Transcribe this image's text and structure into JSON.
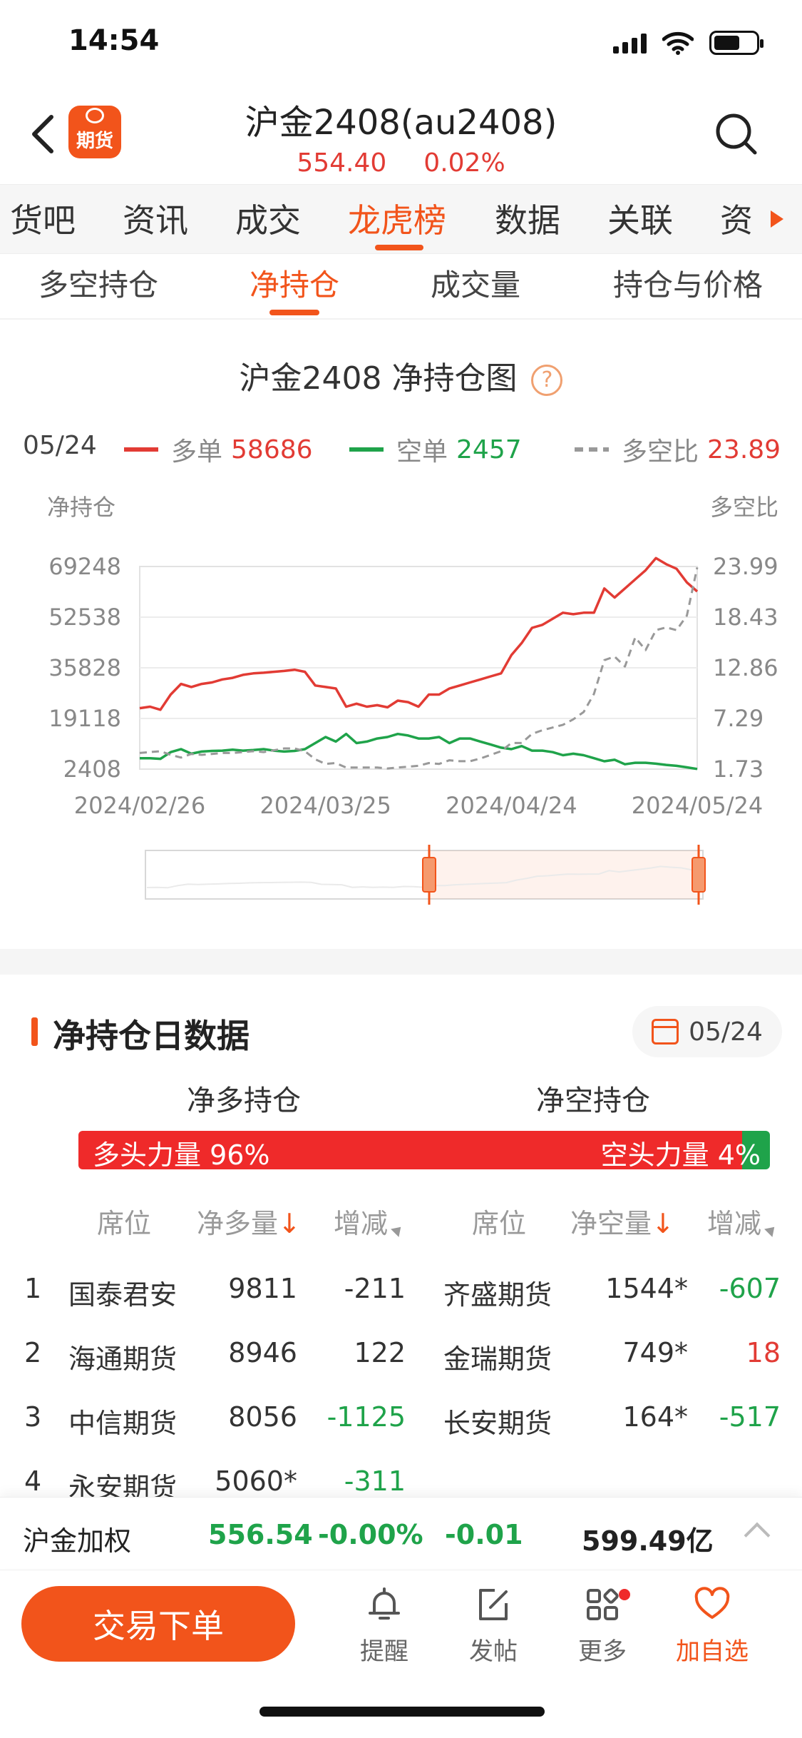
{
  "status_bar": {
    "time": "14:54"
  },
  "header": {
    "logo_text": "期货",
    "title": "沪金2408(au2408)",
    "price": "554.40",
    "change_pct": "0.02%"
  },
  "tabs": [
    {
      "label": "货吧"
    },
    {
      "label": "资讯"
    },
    {
      "label": "成交"
    },
    {
      "label": "龙虎榜"
    },
    {
      "label": "数据"
    },
    {
      "label": "关联"
    },
    {
      "label": "资"
    }
  ],
  "subtabs": [
    {
      "label": "多空持仓"
    },
    {
      "label": "净持仓"
    },
    {
      "label": "成交量"
    },
    {
      "label": "持仓与价格"
    }
  ],
  "chart_section": {
    "title": "沪金2408  净持仓图",
    "help": "?",
    "legend_date": "05/24",
    "legend": [
      {
        "name": "多单",
        "value": "58686",
        "color": "#e23b34"
      },
      {
        "name": "空单",
        "value": "2457",
        "color": "#1fa34a"
      },
      {
        "name": "多空比",
        "value": "23.89",
        "color": "#999999"
      }
    ]
  },
  "chart_data": {
    "type": "line",
    "ylabel_left": "净持仓",
    "ylabel_right": "多空比",
    "y_ticks_left": [
      "69248",
      "52538",
      "35828",
      "19118",
      "2408"
    ],
    "y_ticks_right": [
      "23.99",
      "18.43",
      "12.86",
      "7.29",
      "1.73"
    ],
    "ylim_left": [
      2408,
      69248
    ],
    "ylim_right": [
      1.73,
      23.99
    ],
    "x_ticks": [
      "2024/02/26",
      "2024/03/25",
      "2024/04/24",
      "2024/05/24"
    ],
    "grid": true,
    "series": [
      {
        "name": "多单",
        "axis": "left",
        "color": "#e23b34",
        "values": [
          22500,
          23000,
          22000,
          27000,
          30500,
          29500,
          30500,
          31000,
          32000,
          32500,
          33500,
          34000,
          34200,
          34500,
          34800,
          35200,
          34500,
          30000,
          29500,
          29000,
          23000,
          24000,
          23000,
          23500,
          22800,
          25000,
          24500,
          23000,
          27000,
          27000,
          29000,
          30000,
          31000,
          32000,
          33000,
          34000,
          40000,
          44000,
          49000,
          50000,
          52000,
          54000,
          53500,
          54000,
          54000,
          62000,
          59000,
          62000,
          65000,
          68000,
          72000,
          70000,
          68500,
          64000,
          61000
        ]
      },
      {
        "name": "空单",
        "axis": "left",
        "color": "#1fa34a",
        "values": [
          6000,
          6000,
          5800,
          8000,
          9000,
          7500,
          8200,
          8400,
          8500,
          8800,
          8500,
          8700,
          9000,
          8500,
          8200,
          8400,
          9000,
          11000,
          13000,
          11500,
          14000,
          11000,
          11500,
          12500,
          13000,
          14000,
          13500,
          12500,
          12500,
          13000,
          11000,
          12500,
          12500,
          11500,
          10500,
          9500,
          9000,
          10000,
          8500,
          8500,
          8000,
          7000,
          7500,
          7000,
          6000,
          5000,
          5500,
          4000,
          4500,
          4500,
          4200,
          3800,
          3500,
          3000,
          2457
        ]
      },
      {
        "name": "多空比",
        "axis": "right",
        "color": "#999999",
        "dashed": true,
        "values": [
          3.5,
          3.6,
          3.7,
          3.3,
          3.0,
          3.4,
          3.3,
          3.4,
          3.5,
          3.5,
          3.6,
          3.7,
          3.6,
          3.8,
          4.0,
          4.0,
          3.7,
          2.8,
          2.3,
          2.4,
          1.9,
          1.9,
          1.9,
          1.9,
          1.8,
          1.9,
          2.0,
          2.1,
          2.4,
          2.3,
          2.7,
          2.6,
          2.6,
          2.9,
          3.3,
          3.7,
          4.6,
          4.6,
          5.6,
          6.0,
          6.3,
          6.6,
          7.2,
          8.0,
          10.0,
          13.7,
          14.1,
          13.0,
          16.2,
          14.8,
          17.0,
          17.3,
          17.0,
          18.6,
          23.89
        ]
      }
    ]
  },
  "daily_data": {
    "title": "净持仓日数据",
    "date": "05/24",
    "long_head": "净多持仓",
    "short_head": "净空持仓",
    "long_power_label": "多头力量 96%",
    "short_power_label": "空头力量 4%",
    "long_power_pct": 96,
    "short_power_pct": 4,
    "columns": {
      "seat": "席位",
      "net_long": "净多量",
      "change": "增减",
      "net_short": "净空量",
      "sort_arrow": "↓"
    },
    "rows": [
      {
        "rank": "1",
        "long_seat": "国泰君安",
        "long_qty": "9811",
        "long_chg": "-211",
        "long_chg_dir": "neutral",
        "short_seat": "齐盛期货",
        "short_qty": "1544*",
        "short_chg": "-607",
        "short_chg_dir": "neg"
      },
      {
        "rank": "2",
        "long_seat": "海通期货",
        "long_qty": "8946",
        "long_chg": "122",
        "long_chg_dir": "neutral",
        "short_seat": "金瑞期货",
        "short_qty": "749*",
        "short_chg": "18",
        "short_chg_dir": "pos"
      },
      {
        "rank": "3",
        "long_seat": "中信期货",
        "long_qty": "8056",
        "long_chg": "-1125",
        "long_chg_dir": "neg",
        "short_seat": "长安期货",
        "short_qty": "164*",
        "short_chg": "-517",
        "short_chg_dir": "neg"
      },
      {
        "rank": "4",
        "long_seat": "永安期货",
        "long_qty": "5060*",
        "long_chg": "-311",
        "long_chg_dir": "neg",
        "short_seat": "",
        "short_qty": "",
        "short_chg": "",
        "short_chg_dir": "neutral"
      }
    ]
  },
  "ticker": {
    "name": "沪金加权",
    "price": "556.54",
    "change_pct": "-0.00%",
    "change": "-0.01",
    "volume": "599.49亿"
  },
  "bottom_bar": {
    "trade_button": "交易下单",
    "nav": [
      {
        "label": "提醒",
        "icon": "bell-icon"
      },
      {
        "label": "发帖",
        "icon": "compose-icon"
      },
      {
        "label": "更多",
        "icon": "grid-icon"
      },
      {
        "label": "加自选",
        "icon": "heart-icon"
      }
    ]
  }
}
